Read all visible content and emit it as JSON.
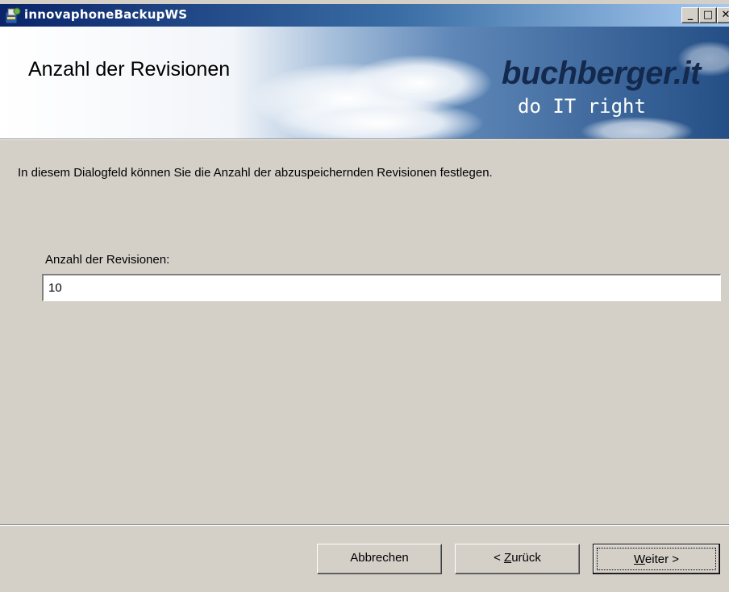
{
  "window": {
    "title": "innovaphoneBackupWS",
    "minimize_glyph": "_",
    "maximize_glyph": "□",
    "close_glyph": "✕"
  },
  "banner": {
    "title": "Anzahl der Revisionen",
    "logo_text": "buchberger.it",
    "logo_tagline": "do IT right"
  },
  "content": {
    "intro_text": "In diesem Dialogfeld können Sie die Anzahl der abzuspeichernden Revisionen festlegen.",
    "field_label": "Anzahl der Revisionen:",
    "field_value": "10"
  },
  "buttons": {
    "cancel": "Abbrechen",
    "back_prefix": "< ",
    "back_mnemonic": "Z",
    "back_rest": "urück",
    "next_mnemonic": "W",
    "next_rest": "eiter >"
  },
  "icons": {
    "app": "installer-icon"
  },
  "colors": {
    "dialog_bg": "#d4d0c8",
    "titlebar_start": "#0a246a",
    "titlebar_end": "#a6caf0",
    "logo": "#13294d"
  }
}
